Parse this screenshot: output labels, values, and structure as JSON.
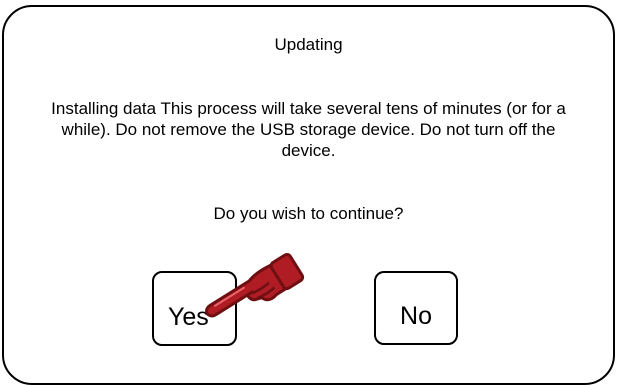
{
  "dialog": {
    "title": "Updating",
    "message": "Installing data This process will take several tens of minutes (or for a while). Do not remove the USB storage device. Do not turn off the device.",
    "question": "Do you wish to continue?",
    "yes_label": "Yes",
    "no_label": "No"
  },
  "icons": {
    "pointer": "pointing-hand-icon"
  },
  "colors": {
    "border": "#000000",
    "background": "#ffffff",
    "hand_fill": "#b01c24",
    "hand_outline": "#6e0f12"
  }
}
